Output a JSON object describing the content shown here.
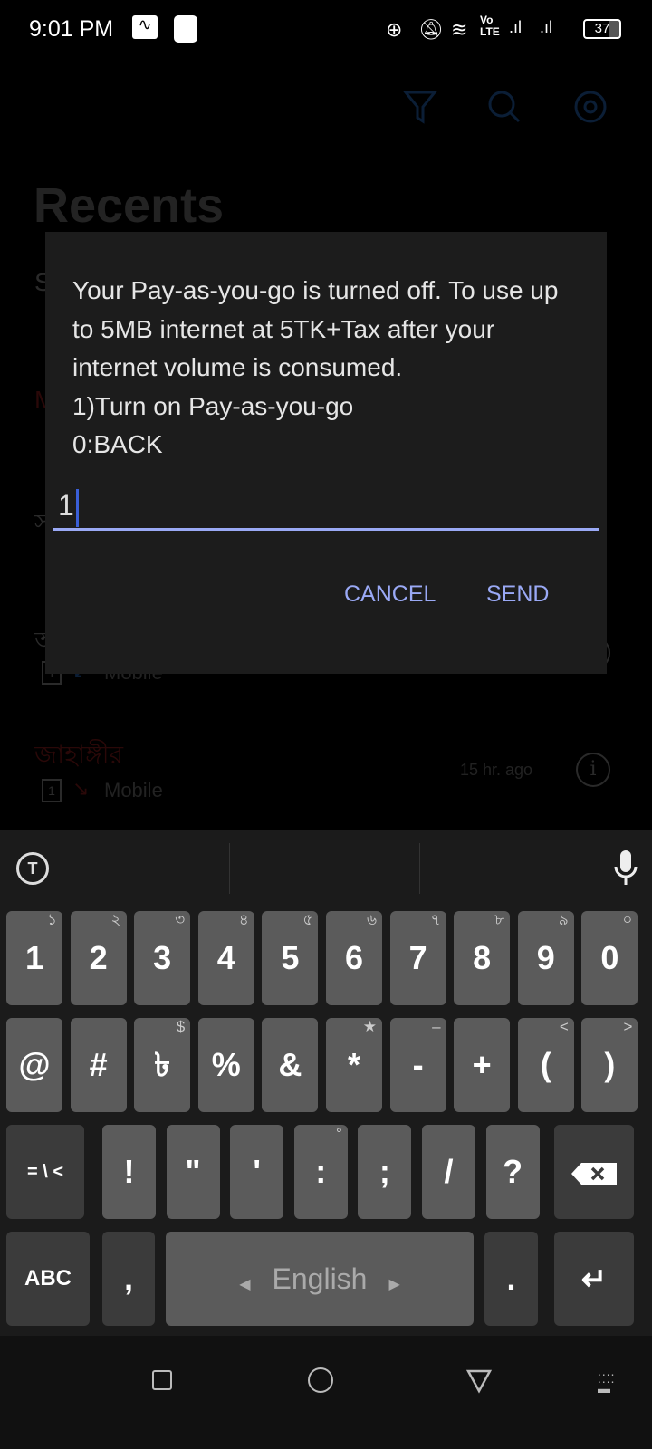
{
  "status_bar": {
    "time": "9:01 PM",
    "battery": "37",
    "icons": [
      "activity-icon",
      "app-icon",
      "data-saver-icon",
      "bell-off-icon",
      "wifi-icon",
      "volte-icon",
      "signal-icon",
      "signal-icon",
      "battery-icon"
    ],
    "volte": "Vo LTE"
  },
  "background": {
    "title": "Recents",
    "toolbar_icons": [
      "filter-icon",
      "search-icon",
      "settings-icon"
    ],
    "rows": [
      {
        "name": "S"
      },
      {
        "name": "M"
      },
      {
        "name": "স"
      },
      {
        "name": "অ",
        "sim": "1",
        "type": "Mobile"
      },
      {
        "name": "জাহাঙ্গীর",
        "sim": "1",
        "type": "Mobile",
        "time": "15 hr. ago"
      }
    ]
  },
  "dialog": {
    "message": "Your Pay-as-you-go is turned off. To use up to 5MB internet at 5TK+Tax after your internet volume is consumed.\n1)Turn on Pay-as-you-go\n0:BACK",
    "input_value": "1",
    "cancel": "CANCEL",
    "send": "SEND",
    "accent": "#9aa9f5"
  },
  "keyboard": {
    "row1": [
      {
        "k": "1",
        "s": "১"
      },
      {
        "k": "2",
        "s": "২"
      },
      {
        "k": "3",
        "s": "৩"
      },
      {
        "k": "4",
        "s": "৪"
      },
      {
        "k": "5",
        "s": "৫"
      },
      {
        "k": "6",
        "s": "৬"
      },
      {
        "k": "7",
        "s": "৭"
      },
      {
        "k": "8",
        "s": "৮"
      },
      {
        "k": "9",
        "s": "৯"
      },
      {
        "k": "0",
        "s": "০"
      }
    ],
    "row2": [
      {
        "k": "@",
        "s": ""
      },
      {
        "k": "#",
        "s": ""
      },
      {
        "k": "৳",
        "s": "$"
      },
      {
        "k": "%",
        "s": ""
      },
      {
        "k": "&",
        "s": ""
      },
      {
        "k": "*",
        "s": "★"
      },
      {
        "k": "-",
        "s": "–"
      },
      {
        "k": "+",
        "s": ""
      },
      {
        "k": "(",
        "s": "<"
      },
      {
        "k": ")",
        "s": ">"
      }
    ],
    "row3": [
      {
        "k": "!",
        "s": ""
      },
      {
        "k": "\"",
        "s": ""
      },
      {
        "k": "'",
        "s": ""
      },
      {
        "k": ":",
        "s": "°"
      },
      {
        "k": ";",
        "s": ""
      },
      {
        "k": "/",
        "s": ""
      },
      {
        "k": "?",
        "s": ""
      }
    ],
    "symbols_key": "= \\ <",
    "abc_key": "ABC",
    "comma": ",",
    "space": "English",
    "period": "."
  }
}
